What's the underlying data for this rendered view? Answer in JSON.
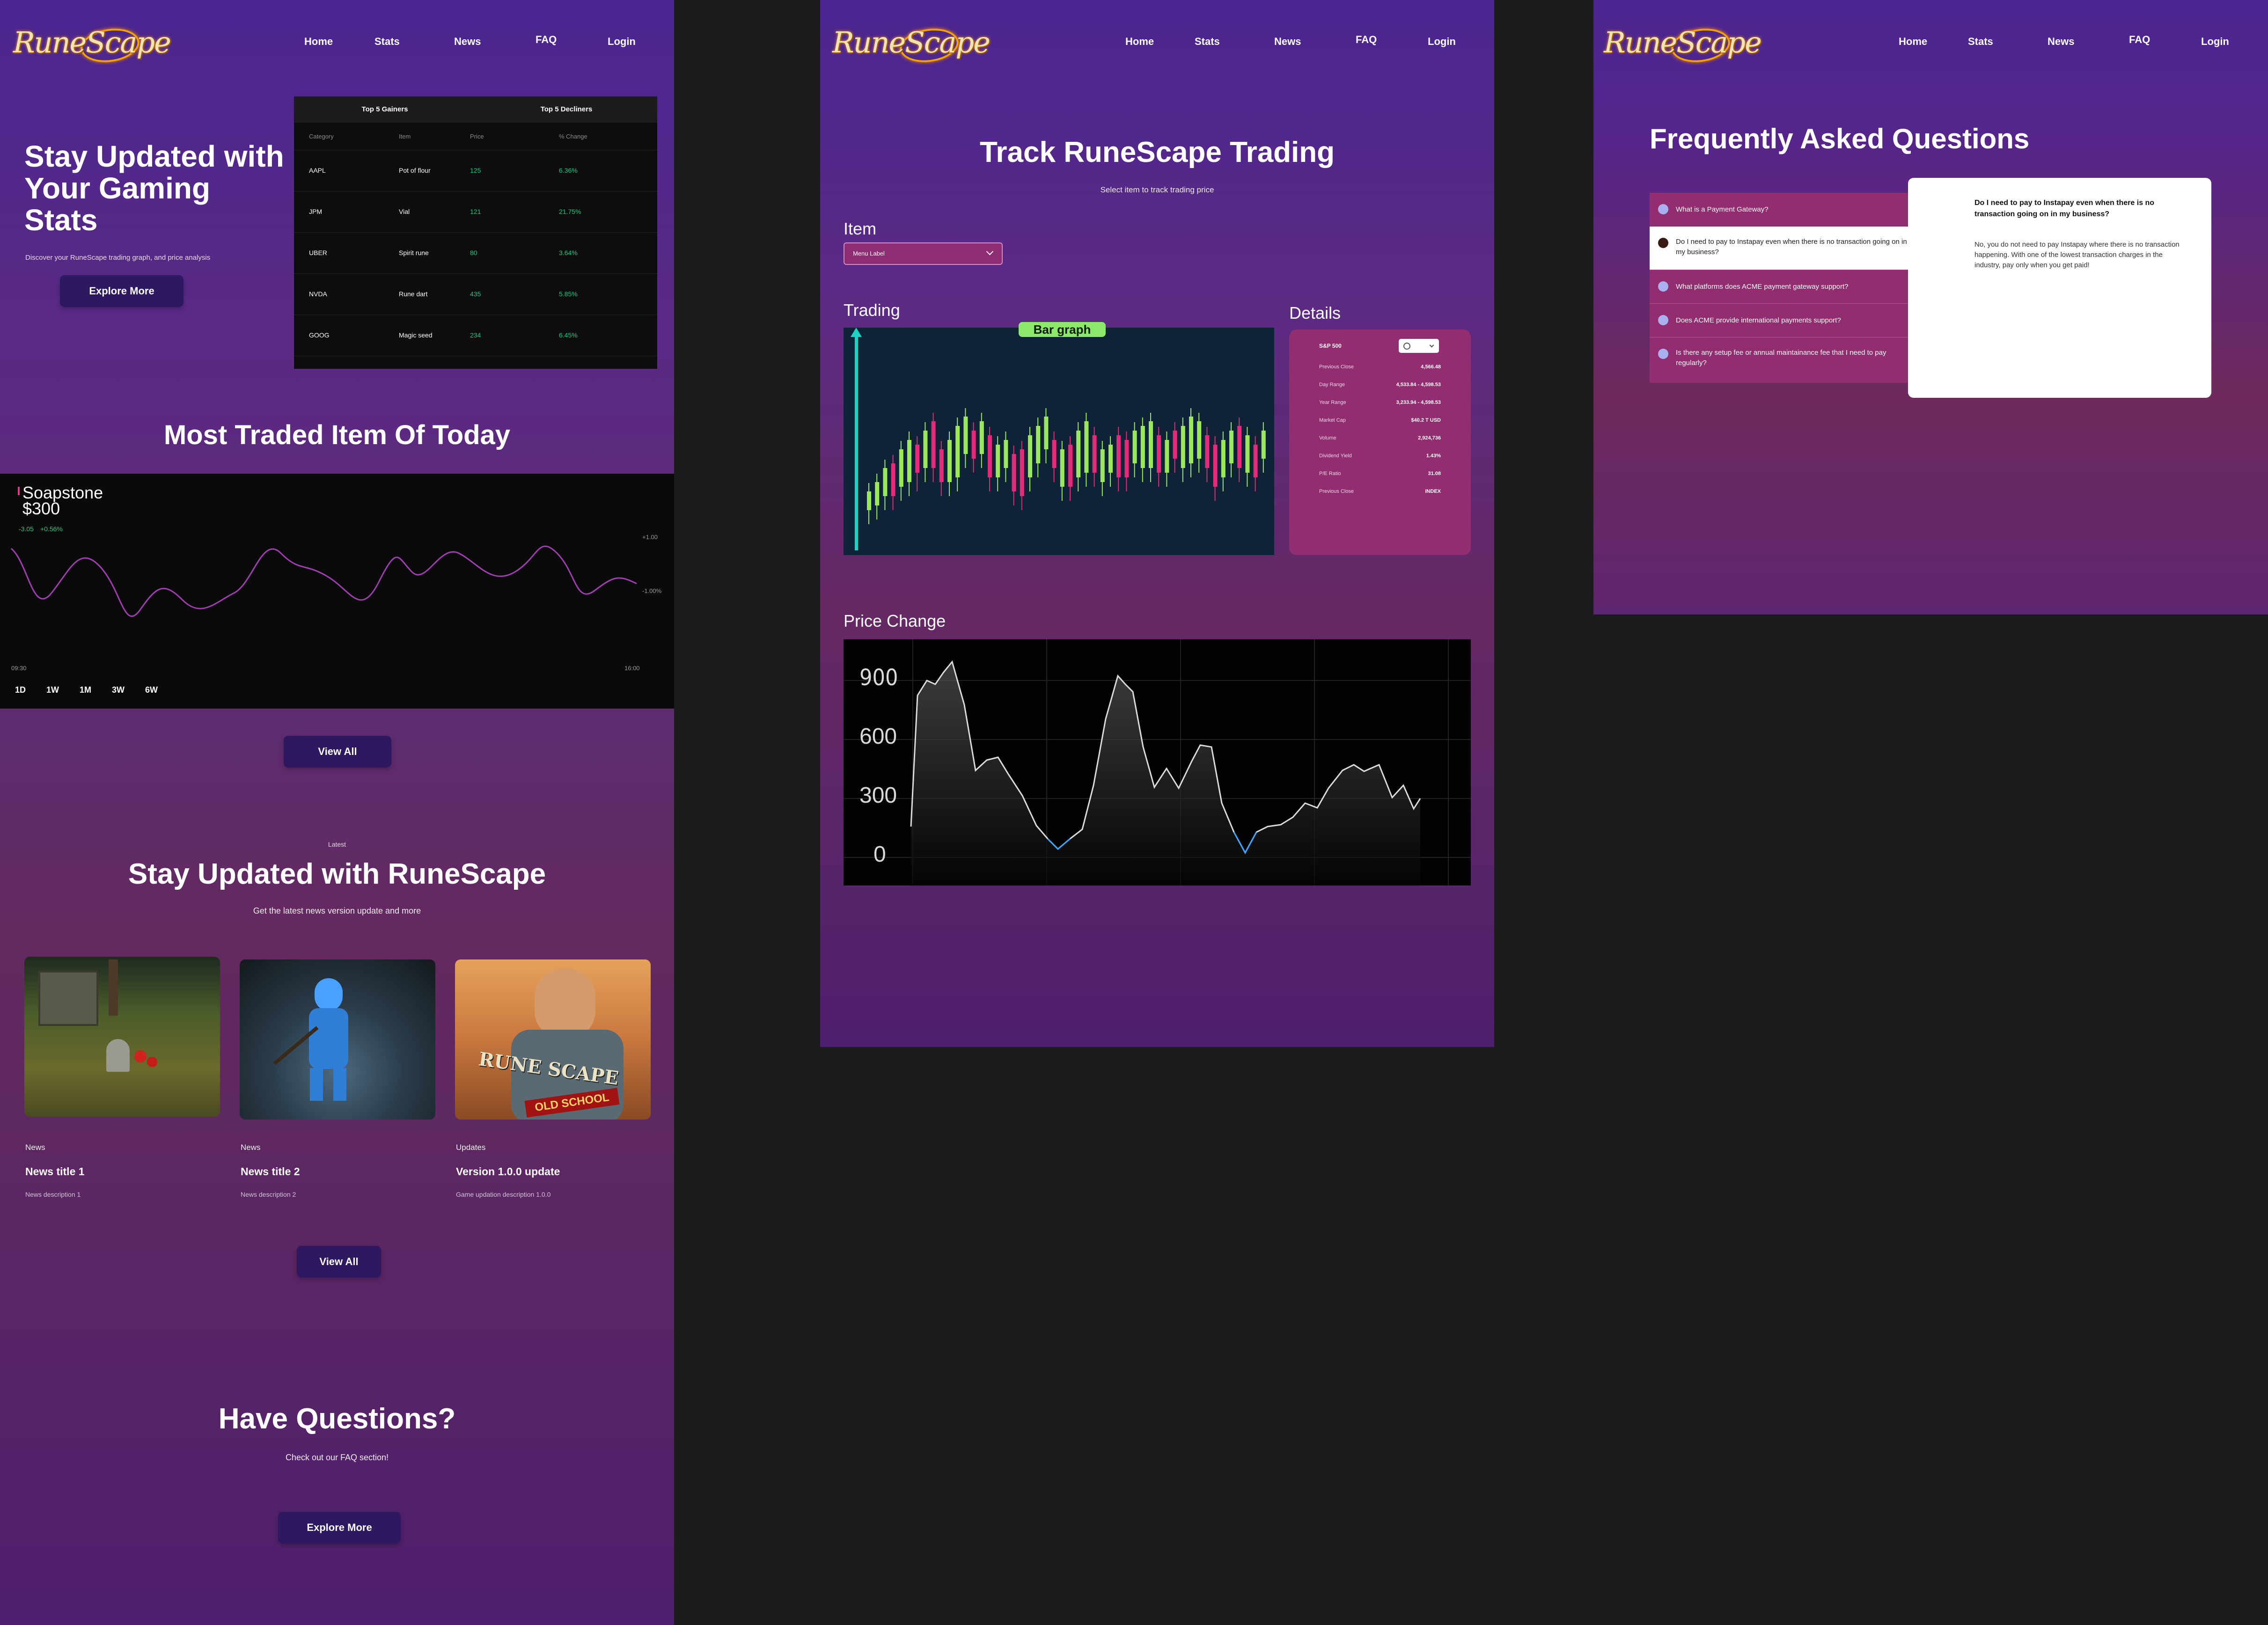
{
  "nav": {
    "logo": "RuneScape",
    "home": "Home",
    "stats": "Stats",
    "news": "News",
    "faq": "FAQ",
    "login": "Login"
  },
  "home": {
    "hero": {
      "title": "Stay Updated with Your Gaming Stats",
      "subtitle": "Discover your RuneScape trading graph, and price analysis",
      "button": "Explore More"
    },
    "movers": {
      "tab_gainers": "Top 5 Gainers",
      "tab_decliners": "Top 5 Decliners",
      "columns": [
        "Category",
        "Item",
        "Price",
        "% Change"
      ],
      "rows": [
        [
          "AAPL",
          "Pot of flour",
          "125",
          "6.36%"
        ],
        [
          "JPM",
          "Vial",
          "121",
          "21.75%"
        ],
        [
          "UBER",
          "Spirit rune",
          "80",
          "3.64%"
        ],
        [
          "NVDA",
          "Rune dart",
          "435",
          "5.85%"
        ],
        [
          "GOOG",
          "Magic seed",
          "234",
          "6.45%"
        ]
      ]
    },
    "most_traded": {
      "title": "Most Traded Item Of Today",
      "item": "Soapstone",
      "price": "$300",
      "change": "-3.05",
      "change_pct": "+0.56%",
      "axis_top": "+1.00",
      "axis_mid": "-1.00%",
      "time_start": "09:30",
      "time_end": "16:00",
      "ranges": [
        "1D",
        "1W",
        "1M",
        "3W",
        "6W"
      ],
      "button": "View All",
      "line_color": "#a03fb0"
    },
    "news": {
      "eyebrow": "Latest",
      "title": "Stay Updated with RuneScape",
      "subtitle": "Get the latest news version update and more",
      "cards": [
        {
          "category": "News",
          "title": "News title 1",
          "description": "News description 1"
        },
        {
          "category": "News",
          "title": "News title 2",
          "description": "News description 2"
        },
        {
          "category": "Updates",
          "title": "Version 1.0.0 update",
          "description": "Game updation description 1.0.0"
        }
      ],
      "logo_line1": "RUNE SCAPE",
      "logo_line2": "OLD SCHOOL",
      "button": "View All"
    },
    "questions": {
      "title": "Have Questions?",
      "subtitle": "Check out our FAQ section!",
      "button": "Explore More"
    }
  },
  "stats": {
    "title": "Track RuneScape Trading",
    "subtitle": "Select item to track trading price",
    "item_label": "Item",
    "select_value": "Menu Label",
    "trading_label": "Trading",
    "badge": "Bar graph",
    "details_label": "Details",
    "details": {
      "symbol": "S&P 500",
      "rows": [
        [
          "Previous Close",
          "4,566.48"
        ],
        [
          "Day Range",
          "4,533.84 - 4,598.53"
        ],
        [
          "Year Range",
          "3,233.94 - 4,598.53"
        ],
        [
          "Market Cap",
          "$40.2 T USD"
        ],
        [
          "Volume",
          "2,924,736"
        ],
        [
          "Dividend Yield",
          "1.43%"
        ],
        [
          "P/E Ratio",
          "31.08"
        ],
        [
          "Previous Close",
          "INDEX"
        ]
      ]
    },
    "price_change_label": "Price Change",
    "price_change_axis": [
      "900",
      "600",
      "300",
      "0"
    ],
    "up_color": "#9be85f",
    "down_color": "#e52a7a"
  },
  "faq": {
    "title": "Frequently Asked Questions",
    "items": [
      "What is a Payment Gateway?",
      "Do I need to pay to Instapay even when there is no transaction going on in my business?",
      "What platforms does ACME payment gateway support?",
      "Does ACME provide international payments support?",
      "Is there any setup fee or annual maintainance fee that I need to pay regularly?"
    ],
    "answer_title": "Do I need to pay to Instapay even when there is no transaction going on in my business?",
    "answer_body": "No, you do not need to pay Instapay where there is no transaction happening. With one of the lowest transaction charges in the industry, pay only when you get paid!"
  }
}
